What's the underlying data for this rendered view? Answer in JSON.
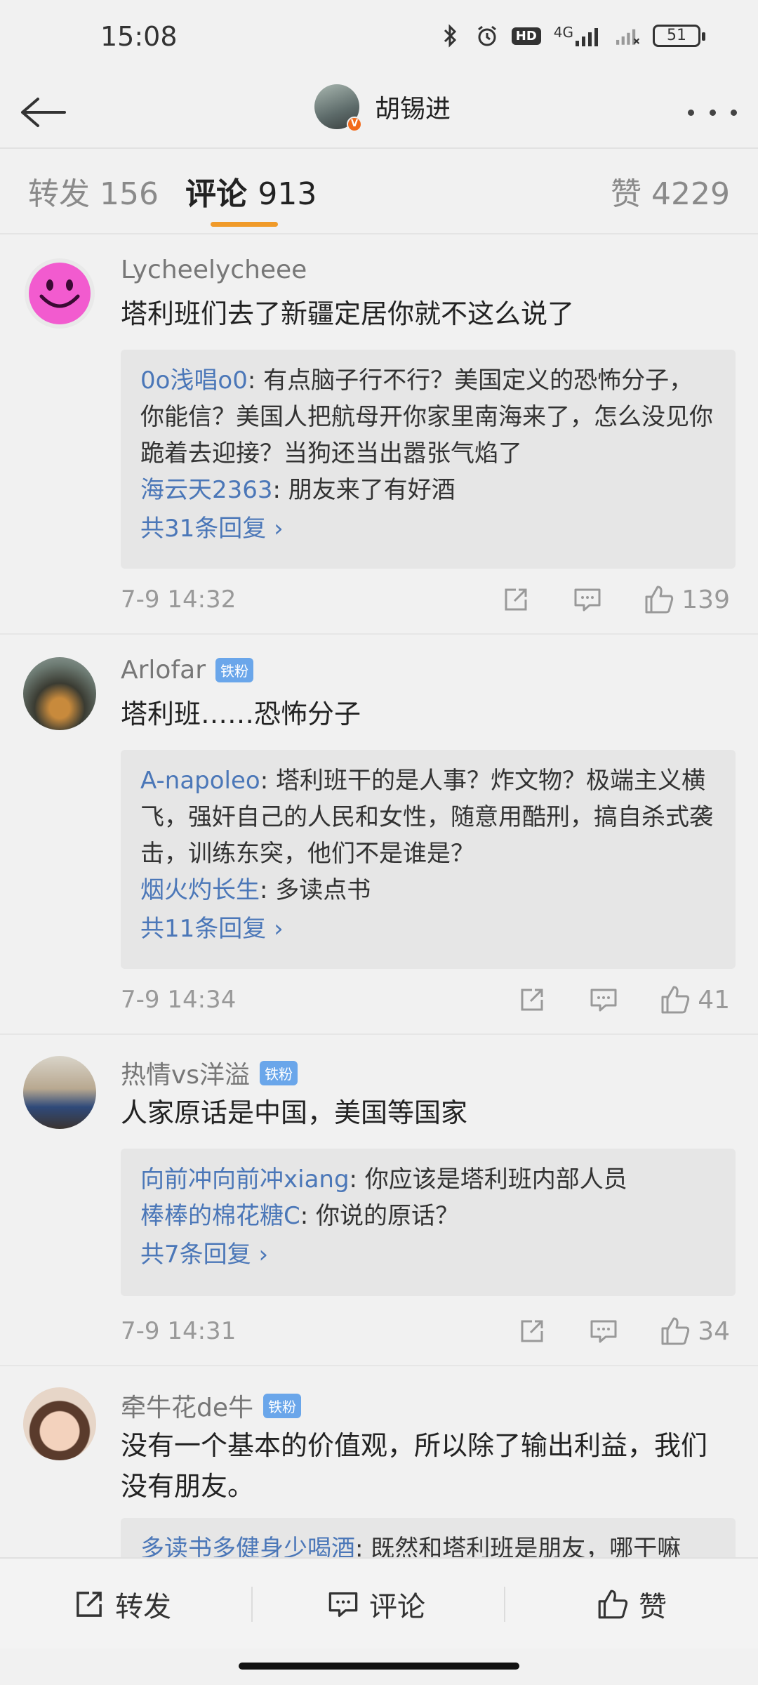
{
  "status": {
    "time": "15:08",
    "network": "4G",
    "hd": "HD",
    "battery": "51"
  },
  "header": {
    "user_name": "胡锡进",
    "verified_badge": "V"
  },
  "tabs": {
    "repost_label": "转发",
    "repost_count": "156",
    "comment_label": "评论",
    "comment_count": "913",
    "like_label": "赞",
    "like_count": "4229"
  },
  "comments": [
    {
      "user": "Lycheelycheee",
      "badge": "",
      "text": "塔利班们去了新疆定居你就不这么说了",
      "replies": [
        {
          "name": "0o浅唱o0",
          "text": ": 有点脑子行不行？美国定义的恐怖分子，你能信？美国人把航母开你家里南海来了，怎么没见你跪着去迎接？当狗还当出嚣张气焰了"
        },
        {
          "name": "海云天2363",
          "text": ": 朋友来了有好酒"
        }
      ],
      "more": "共31条回复 ›",
      "time": "7-9 14:32",
      "likes": "139"
    },
    {
      "user": "Arlofar",
      "badge": "铁粉",
      "text": "塔利班……恐怖分子",
      "replies": [
        {
          "name": "A-napoleo",
          "text": ": 塔利班干的是人事？炸文物？极端主义横飞，强奸自己的人民和女性，随意用酷刑，搞自杀式袭击，训练东突，他们不是谁是？"
        },
        {
          "name": "烟火灼长生",
          "text": ": 多读点书"
        }
      ],
      "more": "共11条回复 ›",
      "time": "7-9 14:34",
      "likes": "41"
    },
    {
      "user": "热情vs洋溢",
      "badge": "铁粉",
      "text": "人家原话是中国，美国等国家",
      "replies": [
        {
          "name": "向前冲向前冲xiang",
          "text": ": 你应该是塔利班内部人员"
        },
        {
          "name": "棒棒的棉花糖C",
          "text": ": 你说的原话？"
        }
      ],
      "more": "共7条回复 ›",
      "time": "7-9 14:31",
      "likes": "34"
    },
    {
      "user": "牵牛花de牛",
      "badge": "铁粉",
      "text": "没有一个基本的价值观，所以除了输出利益，我们没有朋友。",
      "replies": [
        {
          "name": "多读书多健身少喝酒",
          "text": ": 既然和塔利班是朋友，哪干嘛"
        }
      ]
    }
  ],
  "bottom_bar": {
    "repost": "转发",
    "comment": "评论",
    "like": "赞"
  },
  "colors": {
    "accent": "#f09a29",
    "link": "#4b77b8",
    "fan_badge": "#6aa6ea"
  }
}
